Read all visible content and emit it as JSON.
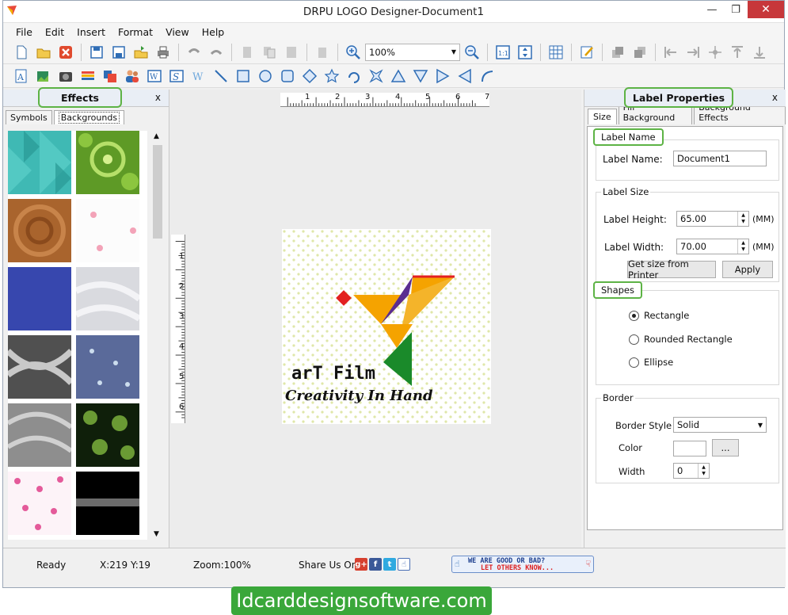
{
  "window": {
    "title": "DRPU LOGO Designer-Document1"
  },
  "menu": [
    "File",
    "Edit",
    "Insert",
    "Format",
    "View",
    "Help"
  ],
  "toolbar": {
    "zoom": "100%"
  },
  "effects": {
    "title": "Effects",
    "close": "x",
    "tabs": [
      "Symbols",
      "Backgrounds"
    ],
    "active_tab": "Backgrounds"
  },
  "canvas": {
    "ruler_h_labels": [
      "1",
      "2",
      "3",
      "4",
      "5",
      "6",
      "7"
    ],
    "ruler_v_labels": [
      "1",
      "2",
      "3",
      "4",
      "5",
      "6"
    ],
    "logo_title": "arT Film",
    "logo_tagline": "Creativity In Hand"
  },
  "props": {
    "title": "Label Properties",
    "close": "x",
    "tabs": [
      "Size",
      "Fill Background",
      "Background Effects"
    ],
    "label_name_group": "Label Name",
    "label_name_label": "Label Name:",
    "label_name_value": "Document1",
    "label_size_group": "Label Size",
    "height_label": "Label Height:",
    "height_value": "65.00",
    "width_label": "Label Width:",
    "width_value": "70.00",
    "unit": "(MM)",
    "printer_button": "Get size from Printer",
    "apply_button": "Apply",
    "shapes_group": "Shapes",
    "shapes": [
      "Rectangle",
      "Rounded Rectangle",
      "Ellipse"
    ],
    "selected_shape": "Rectangle",
    "border_group": "Border",
    "border_style_label": "Border Style",
    "border_style_value": "Solid",
    "color_label": "Color",
    "color_button": "...",
    "width_label2": "Width",
    "border_width_value": "0"
  },
  "status": {
    "state": "Ready",
    "coords": "X:219  Y:19",
    "zoom": "Zoom:100%",
    "share": "Share Us On:",
    "goodbad_line1": "WE ARE GOOD OR BAD?",
    "goodbad_line2": "LET OTHERS KNOW..."
  },
  "footer": "Idcarddesignsoftware.com",
  "colors": {
    "highlight": "#5db345",
    "footer": "#3aa73a",
    "close": "#c7373a"
  }
}
